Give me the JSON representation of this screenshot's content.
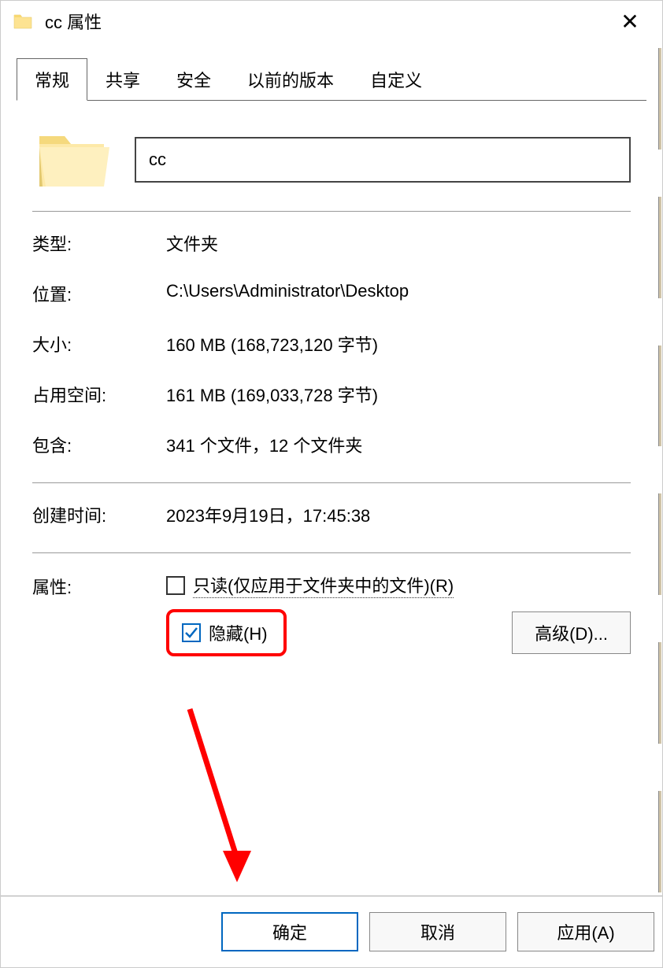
{
  "window": {
    "title": "cc 属性"
  },
  "tabs": {
    "general": "常规",
    "sharing": "共享",
    "security": "安全",
    "previous": "以前的版本",
    "custom": "自定义"
  },
  "general": {
    "name_value": "cc",
    "type_label": "类型:",
    "type_value": "文件夹",
    "location_label": "位置:",
    "location_value": "C:\\Users\\Administrator\\Desktop",
    "size_label": "大小:",
    "size_value": "160 MB (168,723,120 字节)",
    "size_on_disk_label": "占用空间:",
    "size_on_disk_value": "161 MB (169,033,728 字节)",
    "contains_label": "包含:",
    "contains_value": "341 个文件，12 个文件夹",
    "created_label": "创建时间:",
    "created_value": "2023年9月19日，17:45:38",
    "attributes_label": "属性:",
    "readonly_label": "只读(仅应用于文件夹中的文件)(R)",
    "hidden_label": "隐藏(H)",
    "hidden_checked": true,
    "advanced_button": "高级(D)..."
  },
  "footer": {
    "ok": "确定",
    "cancel": "取消",
    "apply": "应用(A)"
  }
}
